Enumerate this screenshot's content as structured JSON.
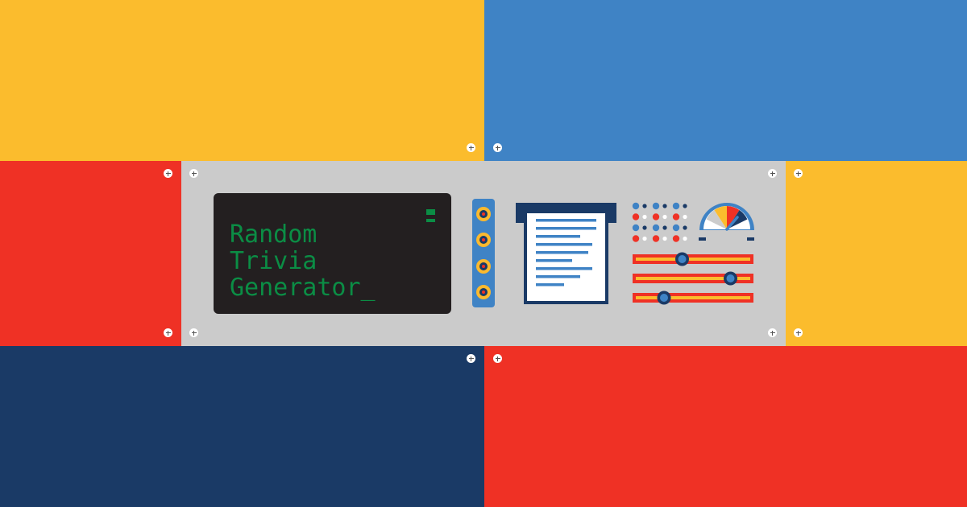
{
  "title": {
    "lines": [
      "Random",
      "Trivia",
      "Generator_"
    ]
  },
  "colors": {
    "yellow": "#fbbc2d",
    "blue": "#3f83c5",
    "red": "#ef3125",
    "navy": "#1a3a66",
    "panel": "#cbcbcb",
    "screen": "#231f20",
    "terminal_text": "#0b8d45"
  },
  "controls": {
    "jack_count": 4,
    "paper_line_count": 9,
    "sliders": [
      {
        "name": "slider-1",
        "value_percent": 41
      },
      {
        "name": "slider-2",
        "value_percent": 81
      },
      {
        "name": "slider-3",
        "value_percent": 26
      }
    ],
    "gauge_needle_percent": 70
  },
  "icons": [
    "screw-icon",
    "terminal-indicator-icon",
    "jack-icon",
    "paper-printout-icon",
    "indicator-lights-icon",
    "gauge-icon",
    "slider-icon"
  ]
}
